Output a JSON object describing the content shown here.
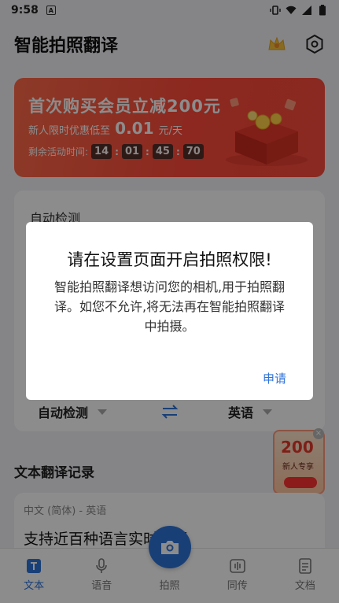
{
  "status_bar": {
    "time": "9:58",
    "notif_icon_label": "A"
  },
  "app_bar": {
    "title": "智能拍照翻译"
  },
  "banner": {
    "headline": "首次购买会员立减200元",
    "sub_prefix": "新人限时优惠低至",
    "price": "0.01",
    "sub_suffix": "元/天",
    "countdown_label": "剩余活动时间:",
    "countdown": [
      "14",
      "01",
      "45",
      "70"
    ]
  },
  "card": {
    "source_lang_label": "自动检测"
  },
  "lang_bar": {
    "source": "自动检测",
    "target": "英语"
  },
  "float_ad": {
    "amount": "200",
    "tag": "新人专享"
  },
  "records": {
    "title": "文本翻译记录",
    "items": [
      {
        "pair": "中文 (简体) - 英语",
        "text": "支持近百种语言实时翻译"
      }
    ]
  },
  "tabs": [
    {
      "label": "文本",
      "icon": "text-icon",
      "active": true
    },
    {
      "label": "语音",
      "icon": "mic-icon",
      "active": false
    },
    {
      "label": "拍照",
      "icon": "camera-icon",
      "active": false
    },
    {
      "label": "同传",
      "icon": "waveform-icon",
      "active": false
    },
    {
      "label": "文档",
      "icon": "document-icon",
      "active": false
    }
  ],
  "dialog": {
    "title": "请在设置页面开启拍照权限!",
    "message": "智能拍照翻译想访问您的相机,用于拍照翻译。如您不允许,将无法再在智能拍照翻译中拍摄。",
    "confirm": "申请"
  },
  "colors": {
    "accent": "#2f73d9",
    "banner": "#ff5a40"
  }
}
